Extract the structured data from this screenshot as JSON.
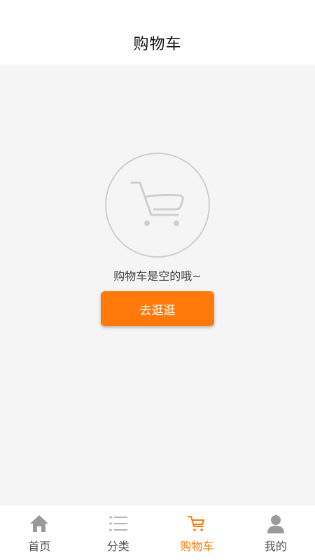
{
  "header": {
    "title": "购物车"
  },
  "empty_state": {
    "icon": "cart-icon",
    "message": "购物车是空的哦~",
    "button_label": "去逛逛"
  },
  "tabbar": {
    "active_index": 2,
    "items": [
      {
        "label": "首页",
        "icon": "home-icon"
      },
      {
        "label": "分类",
        "icon": "list-icon"
      },
      {
        "label": "购物车",
        "icon": "cart-icon"
      },
      {
        "label": "我的",
        "icon": "user-icon"
      }
    ]
  },
  "colors": {
    "accent": "#ff7a0a",
    "icon_gray": "#cfcfcf",
    "tab_gray": "#9a9a9a"
  }
}
